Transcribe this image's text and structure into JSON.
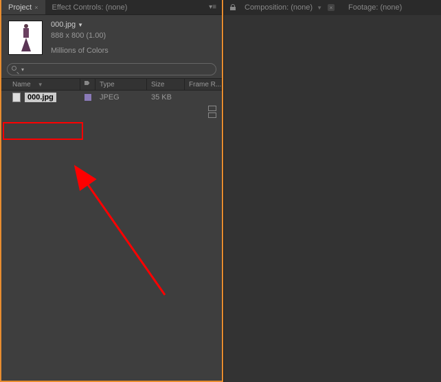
{
  "leftPanel": {
    "tabs": {
      "project": "Project",
      "effectControls": "Effect Controls: (none)"
    },
    "asset": {
      "name": "000.jpg",
      "dimensions": "888 x 800 (1.00)",
      "colorInfo": "Millions of Colors"
    },
    "columns": {
      "name": "Name",
      "type": "Type",
      "size": "Size",
      "frameRate": "Frame R..."
    },
    "files": [
      {
        "name": "000.jpg",
        "type": "JPEG",
        "size": "35 KB",
        "frameRate": ""
      }
    ]
  },
  "rightPanel": {
    "tabs": {
      "composition": "Composition: (none)",
      "footage": "Footage: (none)"
    }
  }
}
